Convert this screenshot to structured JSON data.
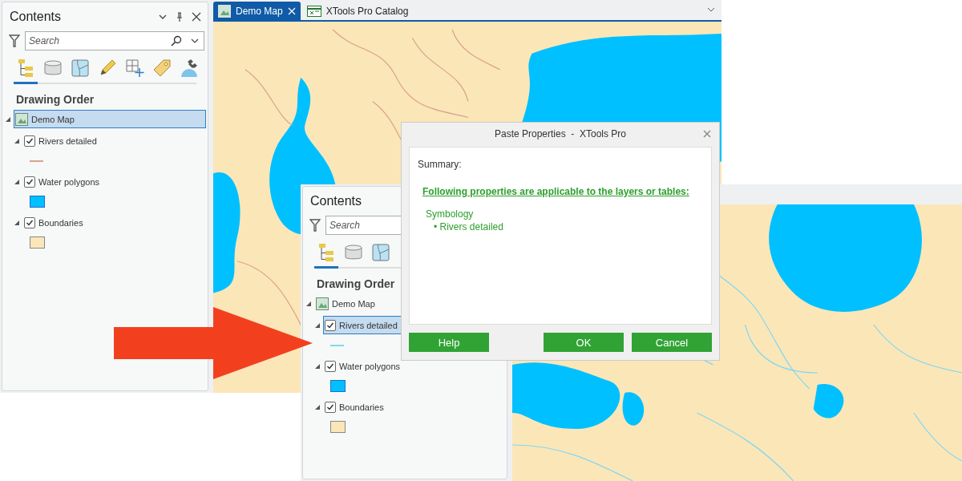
{
  "window_1": {
    "contents": {
      "title": "Contents",
      "header_controls": [
        {
          "kind": "menu"
        },
        {
          "kind": "pin"
        },
        {
          "kind": "close"
        }
      ],
      "search": {
        "placeholder": "Search",
        "buttons": [
          {
            "kind": "search"
          },
          {
            "kind": "dropdown"
          }
        ]
      },
      "tabs": [
        {
          "kind": "tree",
          "selected": true
        },
        {
          "kind": "database",
          "selected": false
        },
        {
          "kind": "map",
          "selected": false
        },
        {
          "kind": "pencil",
          "selected": false
        },
        {
          "kind": "grid",
          "selected": false
        },
        {
          "kind": "tag",
          "selected": false
        },
        {
          "kind": "satellite",
          "selected": false
        }
      ],
      "heading": "Drawing Order",
      "map": {
        "label": "Demo Map",
        "selected": true,
        "expanded": true,
        "children": [
          {
            "label": "Rivers detailed",
            "checked": true,
            "expanded": true,
            "selected": false,
            "kind": "line",
            "color": "#d9a28c"
          },
          {
            "label": "Water polygons",
            "checked": true,
            "expanded": true,
            "selected": false,
            "kind": "fill",
            "color": "#00c0ff"
          },
          {
            "label": "Boundaries",
            "checked": true,
            "expanded": true,
            "selected": false,
            "kind": "fill",
            "color": "#fbe6b8"
          }
        ]
      }
    },
    "map_tabs": [
      {
        "label": "Demo Map",
        "selected": true,
        "kind": "map"
      },
      {
        "label": "XTools Pro Catalog",
        "selected": false,
        "kind": "catalog"
      }
    ]
  },
  "window_2": {
    "contents": {
      "title": "Contents",
      "search": {
        "placeholder": "Search"
      },
      "tabs": [
        {
          "kind": "tree",
          "selected": true
        },
        {
          "kind": "database",
          "selected": false
        },
        {
          "kind": "map",
          "selected": false
        }
      ],
      "heading": "Drawing Order",
      "map": {
        "label": "Demo Map",
        "selected": false,
        "expanded": true,
        "children": [
          {
            "label": "Rivers detailed",
            "checked": true,
            "expanded": true,
            "selected": true,
            "kind": "line",
            "color": "#7fd8f2"
          },
          {
            "label": "Water polygons",
            "checked": true,
            "expanded": true,
            "selected": false,
            "kind": "fill",
            "color": "#00c0ff"
          },
          {
            "label": "Boundaries",
            "checked": true,
            "expanded": true,
            "selected": false,
            "kind": "fill",
            "color": "#fbe6b8"
          }
        ]
      }
    }
  },
  "dialog": {
    "title": "Paste Properties  -  XTools Pro",
    "summary_label": "Summary:",
    "heading": "Following properties are applicable to the layers or tables:",
    "group": "Symbology",
    "items": [
      "• Rivers detailed"
    ],
    "buttons": [
      {
        "label": "Help",
        "kind": "help"
      },
      {
        "label": "OK",
        "kind": "ok"
      },
      {
        "label": "Cancel",
        "kind": "cancel"
      }
    ]
  }
}
